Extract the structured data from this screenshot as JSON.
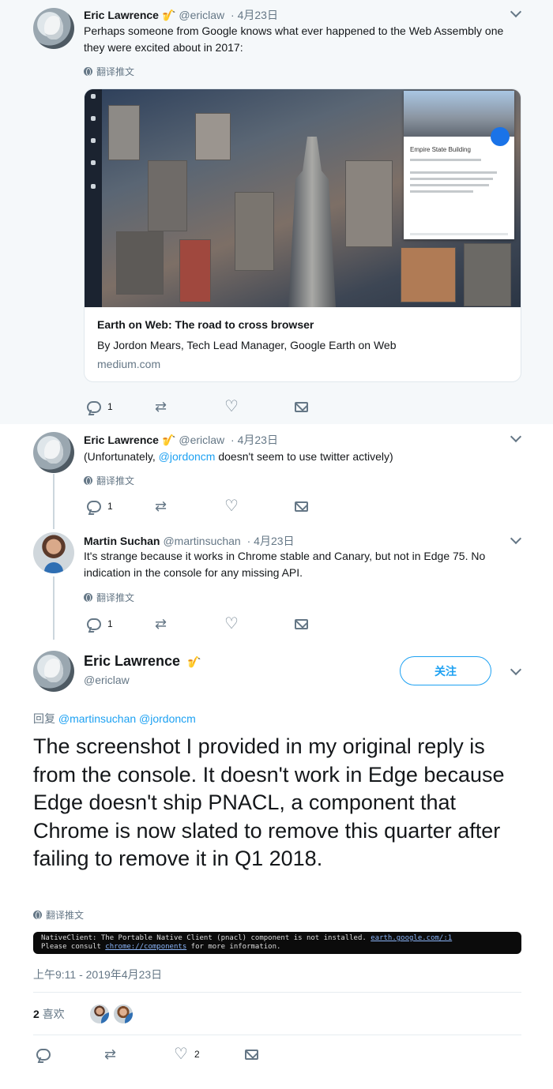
{
  "tweets": [
    {
      "name": "Eric Lawrence",
      "badge": "🎷",
      "handle": "@ericlaw",
      "date": "· 4月23日",
      "text": "Perhaps someone from Google knows what ever happened to the Web Assembly one they were excited about in 2017:",
      "translate": "翻译推文",
      "reply_count": "1",
      "card": {
        "title": "Earth on Web: The road to cross browser",
        "description": "By Jordon Mears, Tech Lead Manager, Google Earth on Web",
        "domain": "medium.com",
        "panel_title": "Empire State Building"
      }
    },
    {
      "name": "Eric Lawrence",
      "badge": "🎷",
      "handle": "@ericlaw",
      "date": "· 4月23日",
      "text_pre": "(Unfortunately, ",
      "mention": "@jordoncm",
      "text_post": " doesn't seem to use twitter actively)",
      "translate": "翻译推文",
      "reply_count": "1"
    },
    {
      "name": "Martin Suchan",
      "handle": "@martinsuchan",
      "date": "· 4月23日",
      "text": "It's strange because it works in Chrome stable and Canary, but not in Edge 75. No indication in the console for any missing API.",
      "translate": "翻译推文",
      "reply_count": "1"
    }
  ],
  "focused": {
    "name": "Eric Lawrence",
    "badge": "🎷",
    "handle": "@ericlaw",
    "follow_label": "关注",
    "reply_prefix": "回复",
    "reply_mentions": "@martinsuchan @jordoncm",
    "text": "The screenshot I provided in my original reply is from the console. It doesn't work in Edge because Edge doesn't ship PNACL, a component that Chrome is now slated to remove this quarter after failing to remove it in Q1 2018.",
    "translate": "翻译推文",
    "console_line1": "NativeClient: The Portable Native Client (pnacl) component is not installed. ",
    "console_link1": "earth.google.com/:1",
    "console_line2a": "Please consult ",
    "console_link2": "chrome://components",
    "console_line2b": " for more information.",
    "timestamp": "上午9:11 - 2019年4月23日",
    "likes_count": "2",
    "likes_label": "喜欢",
    "like_count": "2"
  },
  "icons": {
    "reply": "reply-icon",
    "retweet": "retweet-icon",
    "like": "heart-icon",
    "dm": "envelope-icon"
  },
  "colors": {
    "link": "#1da1f2",
    "secondary": "#657786",
    "thread_line": "#ccd6dd"
  }
}
